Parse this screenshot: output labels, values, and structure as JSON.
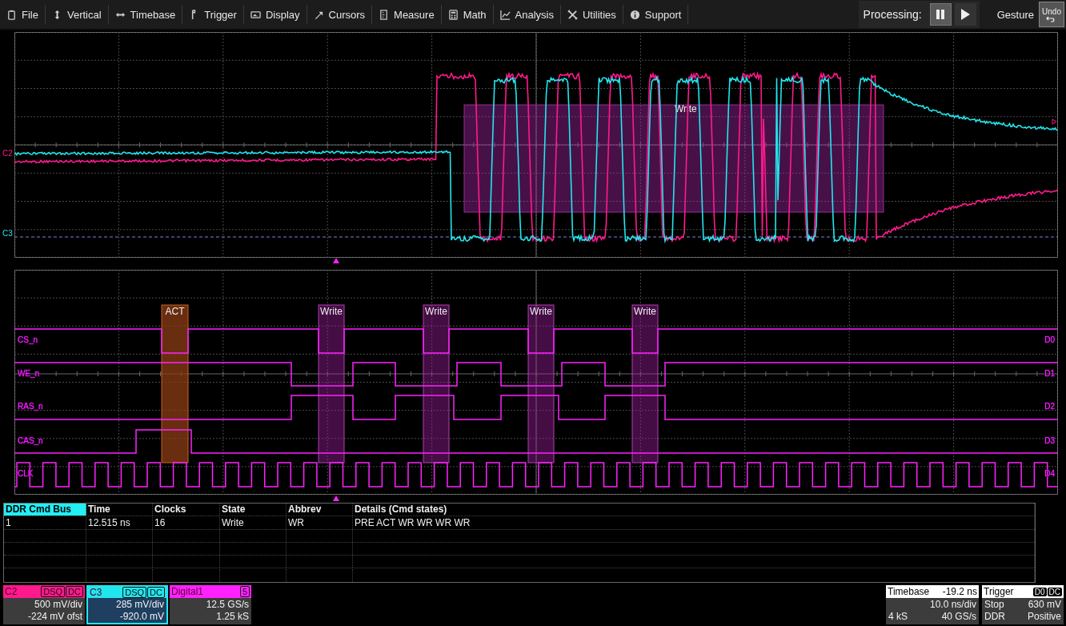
{
  "menu": [
    {
      "label": "File"
    },
    {
      "label": "Vertical"
    },
    {
      "label": "Timebase"
    },
    {
      "label": "Trigger"
    },
    {
      "label": "Display"
    },
    {
      "label": "Cursors"
    },
    {
      "label": "Measure"
    },
    {
      "label": "Math"
    },
    {
      "label": "Analysis"
    },
    {
      "label": "Utilities"
    },
    {
      "label": "Support"
    }
  ],
  "processing": {
    "label": "Processing:",
    "buttons": [
      {
        "kind": "pause",
        "selected": true
      },
      {
        "kind": "play",
        "selected": false
      }
    ]
  },
  "gesture": {
    "label": "Gesture",
    "undo": "Undo"
  },
  "analog": {
    "channels": [
      {
        "name": "C2",
        "color": "#ff1a8c"
      },
      {
        "name": "C3",
        "color": "#22e6ee"
      }
    ],
    "annotation": "Write"
  },
  "digital": {
    "signals": [
      {
        "name": "CS_n",
        "channel": "D0"
      },
      {
        "name": "WE_n",
        "channel": "D1"
      },
      {
        "name": "RAS_n",
        "channel": "D2"
      },
      {
        "name": "CAS_n",
        "channel": "D3"
      },
      {
        "name": "CLK",
        "channel": "D4"
      }
    ],
    "decodes": [
      {
        "label": "ACT",
        "kind": "act"
      },
      {
        "label": "Write",
        "kind": "write"
      },
      {
        "label": "Write",
        "kind": "write"
      },
      {
        "label": "Write",
        "kind": "write"
      },
      {
        "label": "Write",
        "kind": "write"
      }
    ]
  },
  "table": {
    "columns": [
      "DDR Cmd Bus",
      "Time",
      "Clocks",
      "State",
      "Abbrev",
      "Details (Cmd states)"
    ],
    "rows": [
      [
        "1",
        "12.515 ns",
        "16",
        "Write",
        "WR",
        "PRE ACT WR WR WR WR"
      ]
    ]
  },
  "descriptors": [
    {
      "name": "C2",
      "color": "#ff1a8c",
      "badges": [
        "DSQ",
        "DC"
      ],
      "line1": "500 mV/div",
      "line2": "-224 mV ofst",
      "selected": false
    },
    {
      "name": "C3",
      "color": "#22e6ee",
      "badges": [
        "DSQ",
        "DC"
      ],
      "line1": "285 mV/div",
      "line2": "-920.0 mV",
      "selected": true
    },
    {
      "name": "Digital1",
      "color": "#ff22ff",
      "badges": [
        "5"
      ],
      "line1": "12.5 GS/s",
      "line2": "1.25 kS",
      "selected": false
    }
  ],
  "timebase": {
    "label": "Timebase",
    "offset": "-19.2 ns",
    "per_div": "10.0 ns/div",
    "samples": "4 kS",
    "rate": "40 GS/s"
  },
  "trigger": {
    "label": "Trigger",
    "badges": [
      "D0",
      "DC"
    ],
    "mode": "Stop",
    "threshold": "630 mV",
    "type": "DDR",
    "slope": "Positive"
  }
}
